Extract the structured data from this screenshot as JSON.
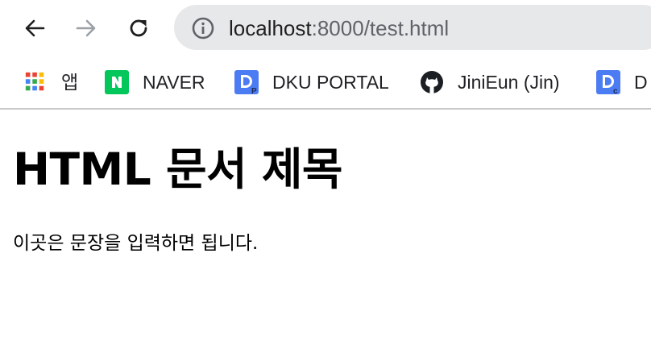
{
  "address_bar": {
    "url_host": "localhost",
    "url_rest": ":8000/test.html"
  },
  "bookmarks": [
    {
      "label": "앱",
      "icon": "apps-grid-icon"
    },
    {
      "label": "NAVER",
      "icon": "naver-icon"
    },
    {
      "label": "DKU PORTAL",
      "icon": "dku-portal-icon"
    },
    {
      "label": "JiniEun (Jin)",
      "icon": "github-icon"
    },
    {
      "label": "D",
      "icon": "dku-icon"
    }
  ],
  "page": {
    "heading": "HTML 문서 제목",
    "paragraph": "이곳은 문장을 입력하면 됩니다."
  },
  "colors": {
    "omnibox_bg": "#e7e8ea",
    "naver_green": "#03c75a",
    "dku_blue": "#4c7cf3"
  }
}
